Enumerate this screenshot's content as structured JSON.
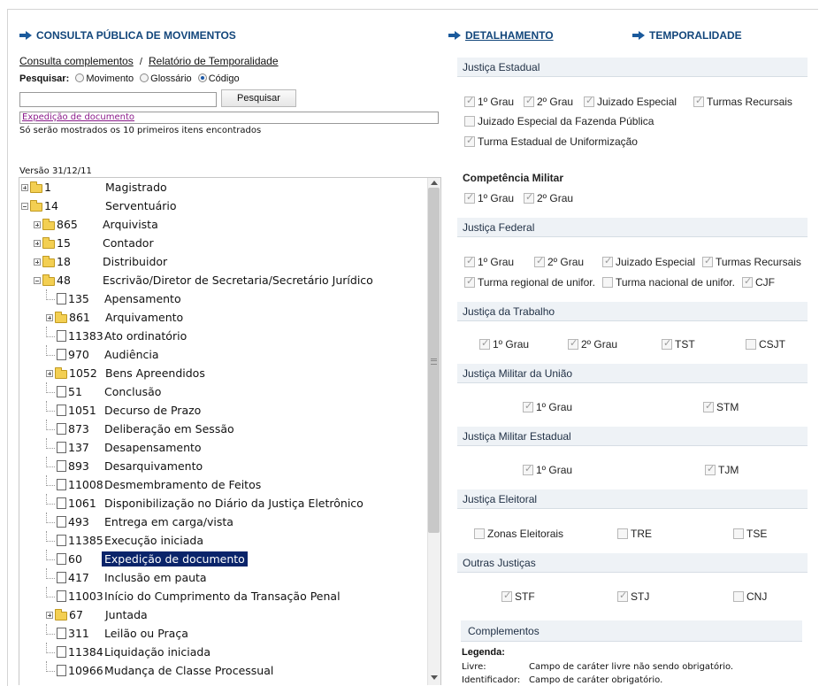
{
  "left": {
    "header": "CONSULTA PÚBLICA DE MOVIMENTOS",
    "link_complementos": "Consulta complementos",
    "sep": "/",
    "link_relatorio": "Relatório de Temporalidade",
    "pesquisar_label": "Pesquisar:",
    "radio_movimento": "Movimento",
    "radio_glossario": "Glossário",
    "radio_codigo": "Código",
    "search_value": "",
    "search_button": "Pesquisar",
    "result_link": "Expedição de documento",
    "result_note": "Só serão mostrados os 10 primeiros itens encontrados",
    "versao": "Versão 31/12/11"
  },
  "tree": [
    {
      "code": "1",
      "label": "Magistrado",
      "type": "folder",
      "toggle": "plus"
    },
    {
      "code": "14",
      "label": "Serventuário",
      "type": "folder",
      "toggle": "minus"
    },
    {
      "code": "865",
      "label": "Arquivista",
      "type": "folder",
      "toggle": "plus"
    },
    {
      "code": "15",
      "label": "Contador",
      "type": "folder",
      "toggle": "plus"
    },
    {
      "code": "18",
      "label": "Distribuidor",
      "type": "folder",
      "toggle": "plus"
    },
    {
      "code": "48",
      "label": "Escrivão/Diretor de Secretaria/Secretário Jurídico",
      "type": "folder",
      "toggle": "minus"
    },
    {
      "code": "135",
      "label": "Apensamento",
      "type": "doc"
    },
    {
      "code": "861",
      "label": "Arquivamento",
      "type": "folder",
      "toggle": "plus"
    },
    {
      "code": "11383",
      "label": "Ato ordinatório",
      "type": "doc"
    },
    {
      "code": "970",
      "label": "Audiência",
      "type": "doc"
    },
    {
      "code": "1052",
      "label": "Bens Apreendidos",
      "type": "folder",
      "toggle": "plus"
    },
    {
      "code": "51",
      "label": "Conclusão",
      "type": "doc"
    },
    {
      "code": "1051",
      "label": "Decurso de Prazo",
      "type": "doc"
    },
    {
      "code": "873",
      "label": "Deliberação em Sessão",
      "type": "doc"
    },
    {
      "code": "137",
      "label": "Desapensamento",
      "type": "doc"
    },
    {
      "code": "893",
      "label": "Desarquivamento",
      "type": "doc"
    },
    {
      "code": "11008",
      "label": "Desmembramento de Feitos",
      "type": "doc"
    },
    {
      "code": "1061",
      "label": "Disponibilização no Diário da Justiça Eletrônico",
      "type": "doc"
    },
    {
      "code": "493",
      "label": "Entrega em carga/vista",
      "type": "doc"
    },
    {
      "code": "11385",
      "label": "Execução iniciada",
      "type": "doc"
    },
    {
      "code": "60",
      "label": "Expedição de documento",
      "type": "doc",
      "selected": true
    },
    {
      "code": "417",
      "label": "Inclusão em pauta",
      "type": "doc"
    },
    {
      "code": "11003",
      "label": "Início do Cumprimento da Transação Penal",
      "type": "doc"
    },
    {
      "code": "67",
      "label": "Juntada",
      "type": "folder",
      "toggle": "plus"
    },
    {
      "code": "311",
      "label": "Leilão ou Praça",
      "type": "doc"
    },
    {
      "code": "11384",
      "label": "Liquidação iniciada",
      "type": "doc"
    },
    {
      "code": "10966",
      "label": "Mudança de Classe Processual",
      "type": "doc"
    }
  ],
  "right": {
    "tab_detalhamento": "DETALHAMENTO",
    "tab_temporalidade": "TEMPORALIDADE",
    "justica_estadual": "Justiça Estadual",
    "je_1grau": "1º Grau",
    "je_2grau": "2º Grau",
    "je_juizado": "Juizado Especial",
    "je_turmas": "Turmas Recursais",
    "je_fazenda": "Juizado Especial da Fazenda Pública",
    "je_uniform": "Turma Estadual de Uniformização",
    "comp_militar": "Competência Militar",
    "cm_1grau": "1º Grau",
    "cm_2grau": "2º Grau",
    "justica_federal": "Justiça Federal",
    "jf_1grau": "1º Grau",
    "jf_2grau": "2º Grau",
    "jf_juizado": "Juizado Especial",
    "jf_turmas": "Turmas Recursais",
    "jf_regional": "Turma regional de unifor.",
    "jf_nacional": "Turma nacional de unifor.",
    "jf_cjf": "CJF",
    "justica_trabalho": "Justiça da Trabalho",
    "jt_1grau": "1º Grau",
    "jt_2grau": "2º Grau",
    "jt_tst": "TST",
    "jt_csjt": "CSJT",
    "militar_uniao": "Justiça Militar da União",
    "mu_1grau": "1º Grau",
    "mu_stm": "STM",
    "militar_estadual": "Justiça Militar Estadual",
    "me_1grau": "1º Grau",
    "me_tjm": "TJM",
    "eleitoral": "Justiça Eleitoral",
    "el_zonas": "Zonas Eleitorais",
    "el_tre": "TRE",
    "el_tse": "TSE",
    "outras": "Outras Justiças",
    "ou_stf": "STF",
    "ou_stj": "STJ",
    "ou_cnj": "CNJ",
    "complementos": "Complementos",
    "legenda": "Legenda:",
    "livre_k": "Livre:",
    "livre_v": "Campo de caráter livre não sendo obrigatório.",
    "ident_k": "Identificador:",
    "ident_v": "Campo de caráter obrigatório."
  }
}
